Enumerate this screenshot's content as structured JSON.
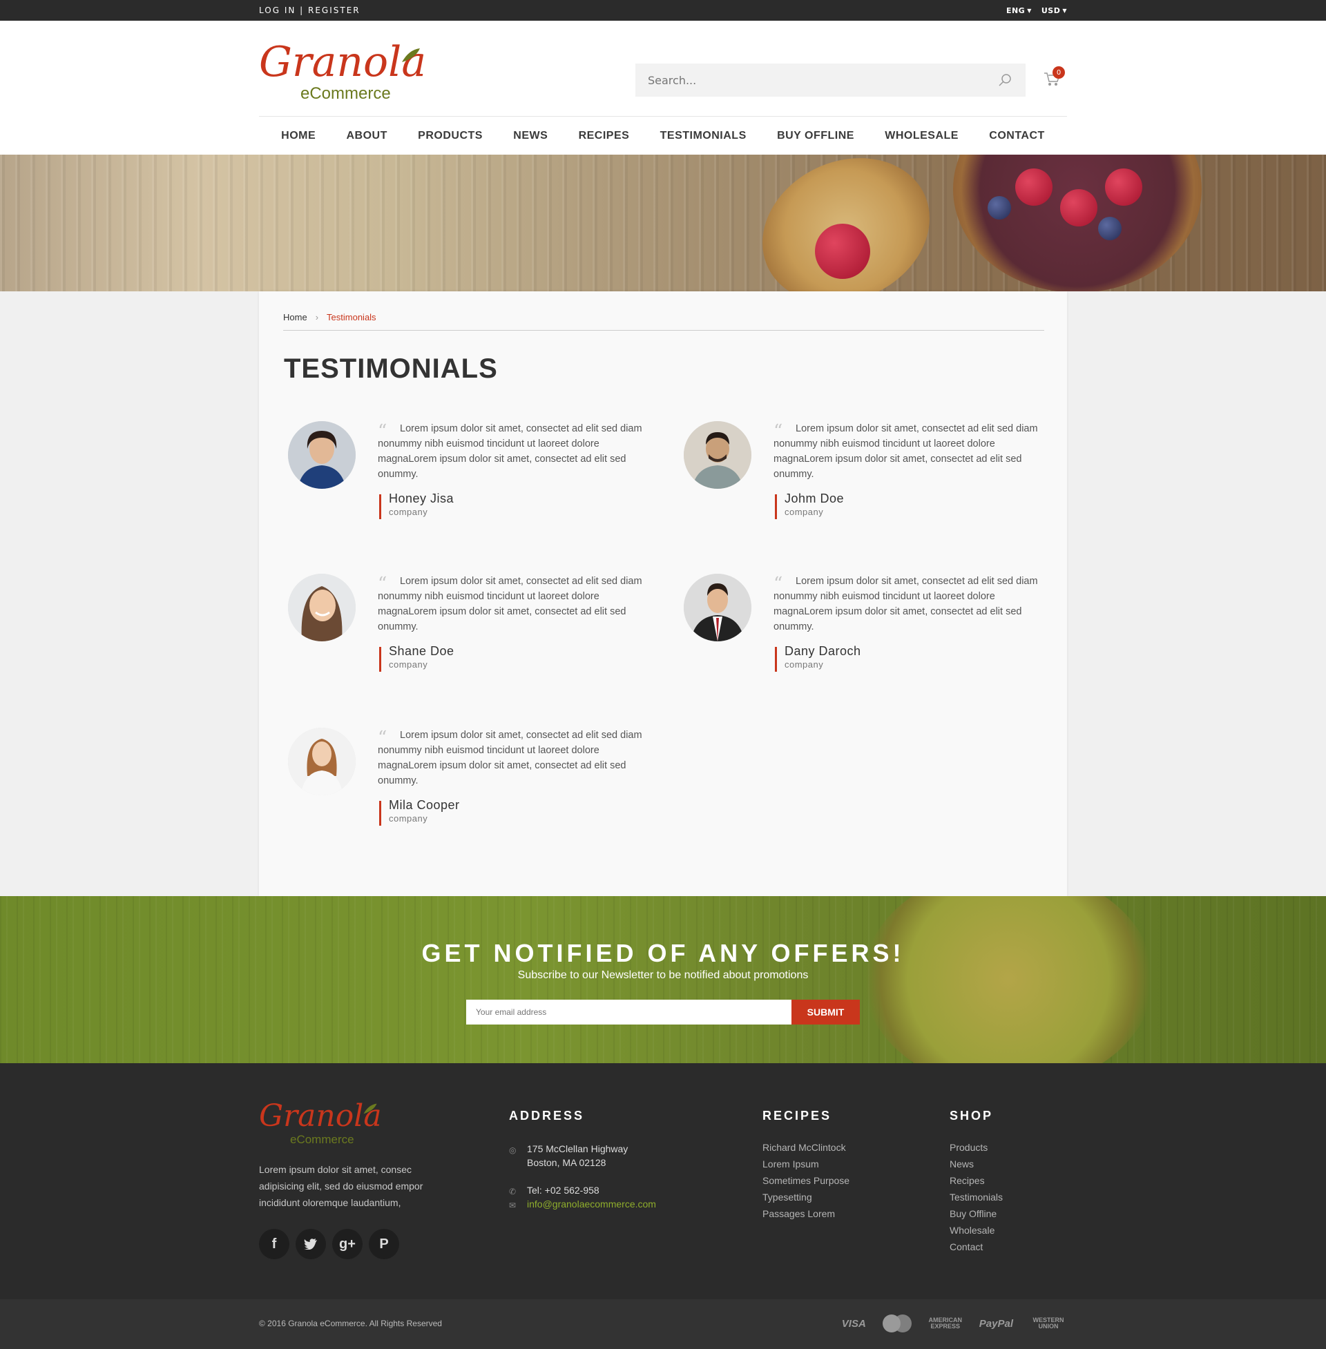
{
  "topbar": {
    "login": "LOG IN | REGISTER",
    "lang": "ENG",
    "currency": "USD"
  },
  "logo": {
    "main": "Granola",
    "sub": "eCommerce"
  },
  "search": {
    "placeholder": "Search..."
  },
  "cart": {
    "count": "0"
  },
  "nav": [
    "HOME",
    "ABOUT",
    "PRODUCTS",
    "NEWS",
    "RECIPES",
    "TESTIMONIALS",
    "BUY OFFLINE",
    "WHOLESALE",
    "CONTACT"
  ],
  "breadcrumb": {
    "home": "Home",
    "current": "Testimonials"
  },
  "page_title": "TESTIMONIALS",
  "testimonials": [
    {
      "text": "Lorem ipsum dolor sit amet, consectet ad elit sed diam nonummy nibh euismod tincidunt ut laoreet dolore magnaLorem ipsum dolor sit amet, consectet ad elit sed onummy.",
      "name": "Honey Jisa",
      "company": "company"
    },
    {
      "text": "Lorem ipsum dolor sit amet, consectet ad elit sed diam nonummy nibh euismod tincidunt ut laoreet dolore magnaLorem ipsum dolor sit amet, consectet ad elit sed onummy.",
      "name": "Johm Doe",
      "company": "company"
    },
    {
      "text": "Lorem ipsum dolor sit amet, consectet ad elit sed diam nonummy nibh euismod tincidunt ut laoreet dolore magnaLorem ipsum dolor sit amet, consectet ad elit sed onummy.",
      "name": "Shane Doe",
      "company": "company"
    },
    {
      "text": "Lorem ipsum dolor sit amet, consectet ad elit sed diam nonummy nibh euismod tincidunt ut laoreet dolore magnaLorem ipsum dolor sit amet, consectet ad elit sed onummy.",
      "name": "Dany Daroch",
      "company": "company"
    },
    {
      "text": "Lorem ipsum dolor sit amet, consectet ad elit sed diam nonummy nibh euismod tincidunt ut laoreet dolore magnaLorem ipsum dolor sit amet, consectet ad elit sed onummy.",
      "name": "Mila Cooper",
      "company": "company"
    }
  ],
  "newsletter": {
    "title": "GET NOTIFIED OF ANY OFFERS!",
    "subtitle": "Subscribe to our Newsletter to be notified about promotions",
    "placeholder": "Your email address",
    "submit": "SUBMIT"
  },
  "footer": {
    "about": "Lorem ipsum dolor sit amet, consec adipisicing elit, sed do eiusmod empor incididunt oloremque laudantium,",
    "address_title": "ADDRESS",
    "address_line1": "175 McClellan Highway",
    "address_line2": "Boston, MA 02128",
    "tel": "Tel: +02 562-958",
    "email": "info@granolaecommerce.com",
    "recipes_title": "RECIPES",
    "recipes": [
      "Richard McClintock",
      "Lorem Ipsum",
      "Sometimes Purpose",
      "Typesetting",
      "Passages  Lorem"
    ],
    "shop_title": "SHOP",
    "shop": [
      "Products",
      "News",
      "Recipes",
      "Testimonials",
      "Buy Offline",
      "Wholesale",
      "Contact"
    ],
    "social_icons": [
      "facebook-icon",
      "twitter-icon",
      "google-plus-icon",
      "pinterest-icon"
    ]
  },
  "bottom": {
    "copyright": "© 2016 Granola eCommerce. All Rights Reserved",
    "payments": [
      "VISA",
      "MasterCard",
      "AMERICAN EXPRESS",
      "PayPal",
      "WESTERN UNION"
    ]
  },
  "colors": {
    "accent": "#c9361c",
    "brand_green": "#6b7a1f",
    "dark": "#2b2b2b"
  }
}
